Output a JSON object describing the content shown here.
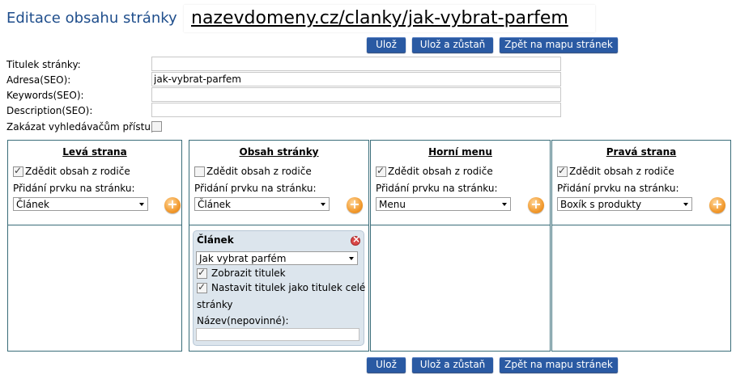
{
  "header": {
    "title": "Editace obsahu stránky",
    "url": "nazevdomeny.cz/clanky/jak-vybrat-parfem"
  },
  "toolbar": {
    "save_label": "Ulož",
    "save_stay_label": "Ulož a zůstaň",
    "back_label": "Zpět na mapu stránek"
  },
  "form": {
    "title_label": "Titulek stránky:",
    "title_value": "",
    "address_label": "Adresa(SEO):",
    "address_value": "jak-vybrat-parfem",
    "keywords_label": "Keywords(SEO):",
    "keywords_value": "",
    "description_label": "Description(SEO):",
    "description_value": "",
    "block_robots_label": "Zakázat vyhledávačům přístup:",
    "block_robots_checked": false
  },
  "panels": [
    {
      "title": "Levá strana",
      "inherit_label": "Zdědit obsah z rodiče",
      "inherit_checked": true,
      "add_label": "Přidání prvku na stránku:",
      "selected": "Článek"
    },
    {
      "title": "Obsah stránky",
      "inherit_label": "Zdědit obsah z rodiče",
      "inherit_checked": false,
      "add_label": "Přidání prvku na stránku:",
      "selected": "Článek"
    },
    {
      "title": "Horní menu",
      "inherit_label": "Zdědit obsah z rodiče",
      "inherit_checked": true,
      "add_label": "Přidání prvku na stránku:",
      "selected": "Menu"
    },
    {
      "title": "Pravá strana",
      "inherit_label": "Zdědit obsah z rodiče",
      "inherit_checked": true,
      "add_label": "Přidání prvku na stránku:",
      "selected": "Boxík s produkty"
    }
  ],
  "article_widget": {
    "title": "Článek",
    "selected_article": "Jak vybrat parfém",
    "show_title_label": "Zobrazit titulek",
    "show_title_checked": true,
    "set_page_title_label_1": "Nastavit titulek jako titulek celé",
    "set_page_title_label_2": "stránky",
    "set_page_title_checked": true,
    "name_label": "Název(nepovinné):",
    "name_value": ""
  },
  "icons": {
    "add": "add-circle-icon",
    "close": "close-circle-icon",
    "dropdown": "chevron-down-icon"
  },
  "colors": {
    "title": "#1f4e8c",
    "button": "#2a5aa3",
    "panel_border": "#3a6d79",
    "widget_bg": "#dce5ed"
  }
}
